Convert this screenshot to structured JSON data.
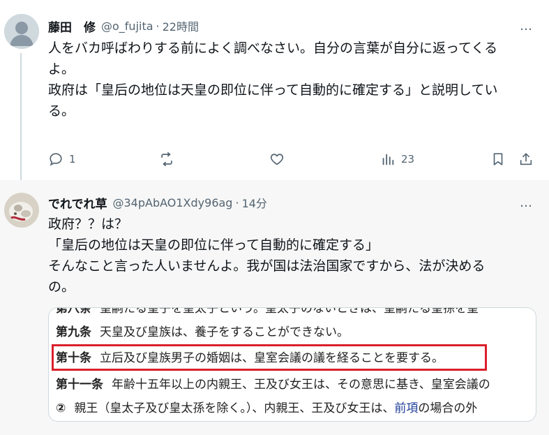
{
  "tweet1": {
    "name": "藤田　修",
    "handle": "@o_fujita",
    "separator": "·",
    "time": "22時間",
    "more_icon": "…",
    "lines": [
      "人をバカ呼ばわりする前によく調べなさい。自分の言葉が自分に返ってくる",
      "よ。",
      "",
      "政府は「皇后の地位は天皇の即位に伴って自動的に確定する」と説明してい",
      "る。"
    ],
    "actions": {
      "reply_count": "1",
      "retweet_count": "",
      "like_count": "",
      "views_count": "23"
    }
  },
  "tweet2": {
    "name": "でれでれ草",
    "handle": "@34pAbAO1Xdy96ag",
    "separator": "·",
    "time": "14分",
    "more_icon": "…",
    "lines": [
      "政府？？は？",
      "「皇后の地位は天皇の即位に伴って自動的に確定する」",
      "そんなこと言った人いませんよ。我が国は法治国家ですから、法が決める",
      "の。"
    ]
  },
  "embed": {
    "rows": [
      {
        "num": "第八条",
        "text": "皇嗣たる皇子を皇太子という。皇太子のないときは、皇嗣たる皇孫を皇"
      },
      {
        "num": "第九条",
        "text": "天皇及び皇族は、養子をすることができない。"
      },
      {
        "num": "第十条",
        "text": "立后及び皇族男子の婚姻は、皇室会議の議を経ることを要する。"
      },
      {
        "num": "第十一条",
        "text": "年齢十五年以上の内親王、王及び女王は、その意思に基き、皇室会議の"
      },
      {
        "num": "②",
        "text_before": "親王（皇太子及び皇太孫を除く。）、内親王、王及び女王は、",
        "link": "前項",
        "text_after": "の場合の外"
      }
    ]
  },
  "colors": {
    "text": "#0f1419",
    "muted": "#536471",
    "highlight_border": "#d9202a",
    "link": "#1f3f99"
  }
}
